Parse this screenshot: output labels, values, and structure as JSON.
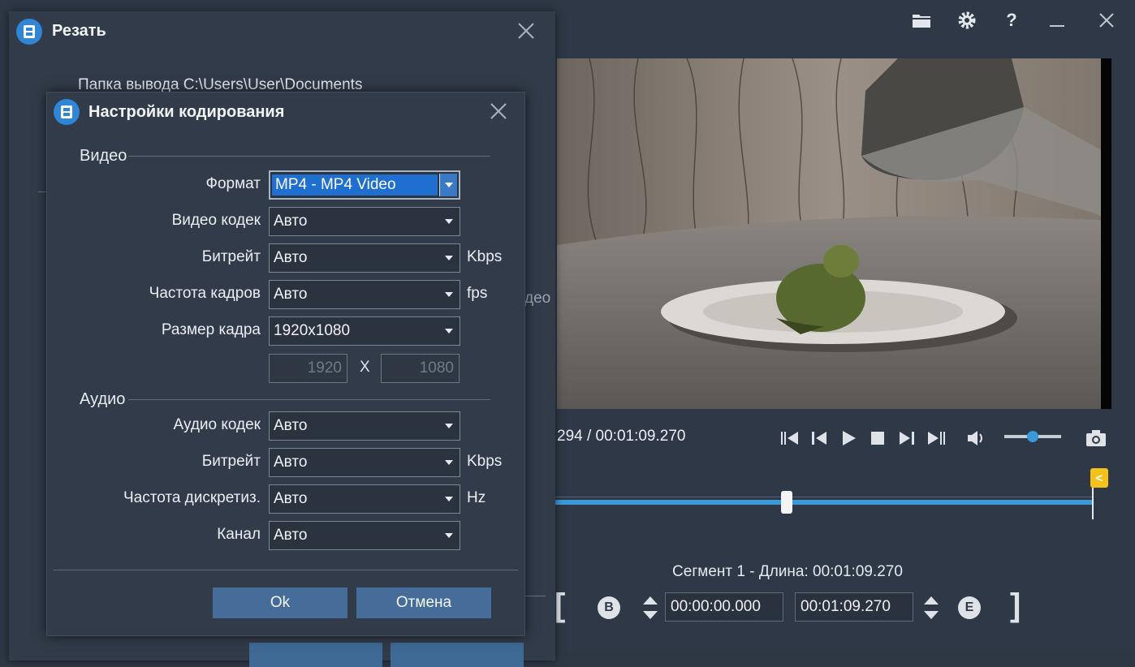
{
  "app": {
    "time_readout": "294 / 00:01:09.270",
    "segment_info": "Сегмент 1 - Длина: 00:01:09.270",
    "start_time": "00:00:00.000",
    "end_time": "00:01:09.270",
    "start_button": "B",
    "end_button": "E",
    "volume_level": 0.5,
    "playhead_position": 0.43
  },
  "cut_dialog": {
    "title": "Резать",
    "output_folder": "Папка вывода  C:\\Users\\User\\Documents",
    "side_text": "део"
  },
  "encoding_dialog": {
    "title": "Настройки кодирования",
    "video_section": "Видео",
    "audio_section": "Аудио",
    "video": {
      "format_label": "Формат",
      "format_value": "MP4 - MP4 Video",
      "codec_label": "Видео кодек",
      "codec_value": "Авто",
      "bitrate_label": "Битрейт",
      "bitrate_value": "Авто",
      "bitrate_unit": "Kbps",
      "framerate_label": "Частота кадров",
      "framerate_value": "Авто",
      "framerate_unit": "fps",
      "size_label": "Размер кадра",
      "size_value": "1920x1080",
      "width": "1920",
      "height": "1080",
      "size_separator": "X"
    },
    "audio": {
      "codec_label": "Аудио кодек",
      "codec_value": "Авто",
      "bitrate_label": "Битрейт",
      "bitrate_value": "Авто",
      "bitrate_unit": "Kbps",
      "samplerate_label": "Частота дискретиз.",
      "samplerate_value": "Авто",
      "samplerate_unit": "Hz",
      "channel_label": "Канал",
      "channel_value": "Авто"
    },
    "ok_label": "Ok",
    "cancel_label": "Отмена"
  }
}
